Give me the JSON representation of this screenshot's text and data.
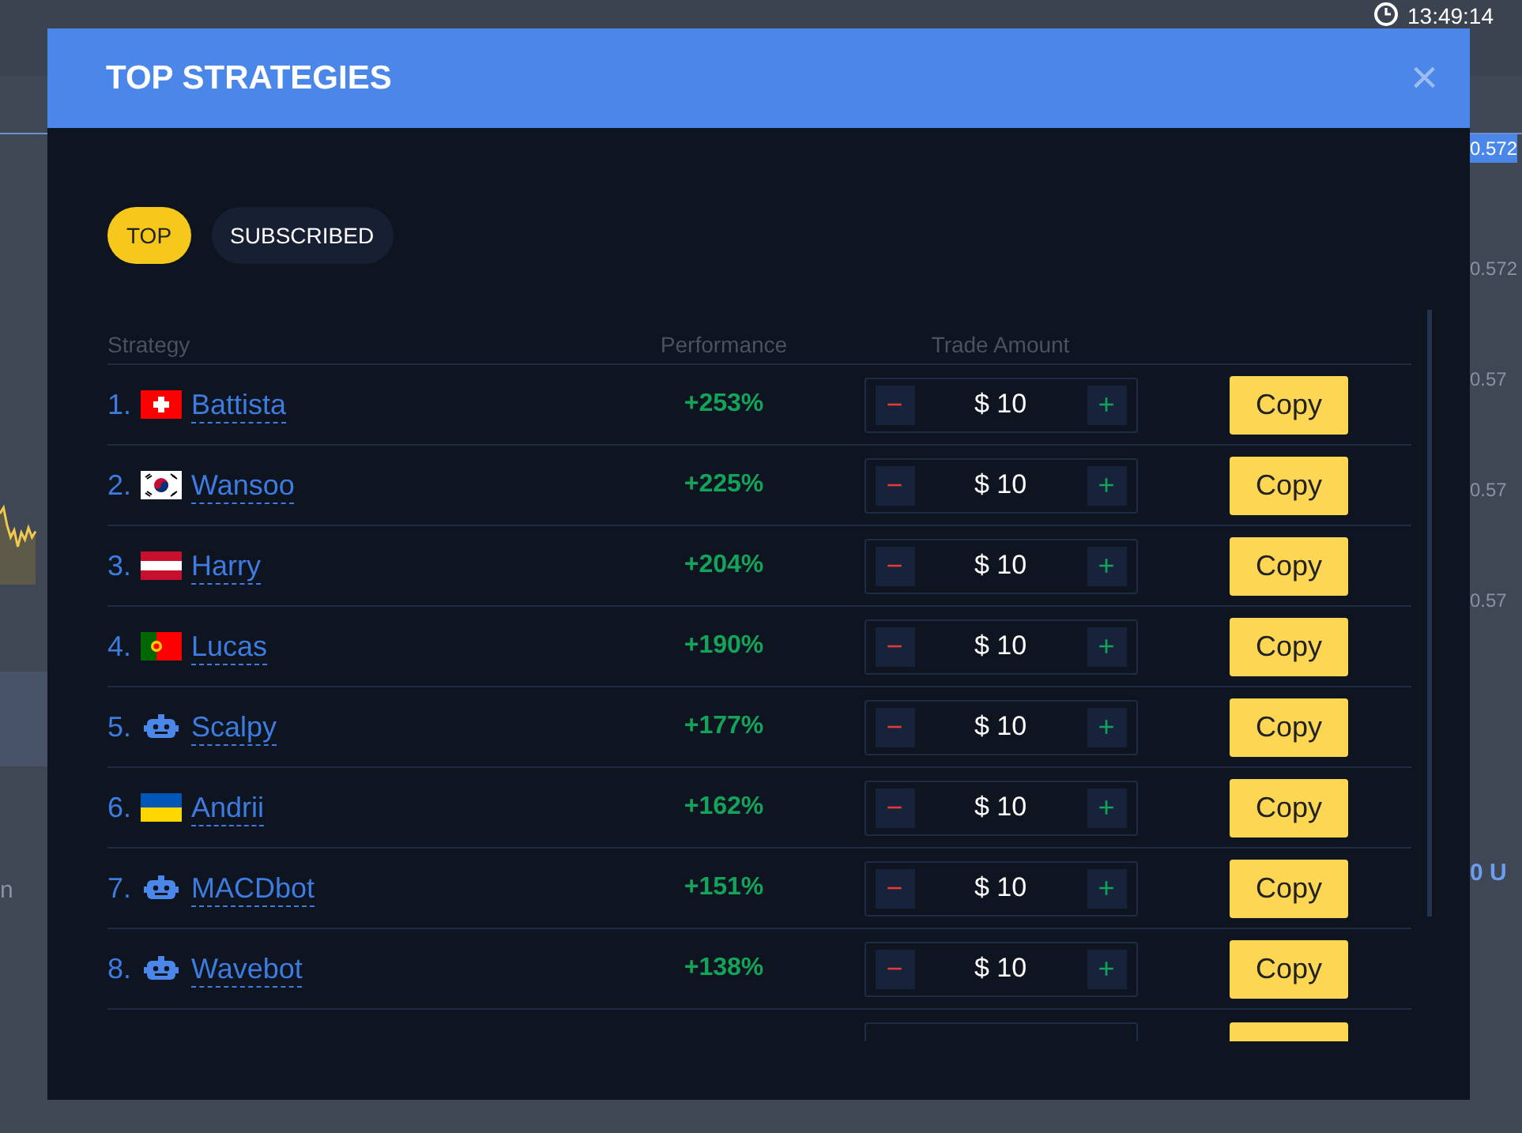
{
  "background": {
    "clock": "13:49:14",
    "price_labels": [
      {
        "text": "0.572",
        "selected": true
      },
      {
        "text": "0.572",
        "selected": false
      },
      {
        "text": "0.57",
        "selected": false
      },
      {
        "text": "0.57",
        "selected": false
      },
      {
        "text": "0.57",
        "selected": false
      }
    ],
    "balance_fragment": "0 U",
    "left_fragment": "n"
  },
  "modal": {
    "title": "TOP STRATEGIES",
    "close": "×",
    "tabs": [
      {
        "label": "TOP",
        "selected": true
      },
      {
        "label": "SUBSCRIBED",
        "selected": false
      }
    ],
    "table": {
      "columns": [
        "Strategy",
        "Performance",
        "Trade Amount"
      ],
      "rows": [
        {
          "rank": "1.",
          "kind": "switzerland",
          "name": "Battista",
          "performance": "+253%",
          "amount": "$ 10",
          "minus": "−",
          "plus": "+",
          "action": "Copy"
        },
        {
          "rank": "2.",
          "kind": "korea",
          "name": "Wansoo",
          "performance": "+225%",
          "amount": "$ 10",
          "minus": "−",
          "plus": "+",
          "action": "Copy"
        },
        {
          "rank": "3.",
          "kind": "austria",
          "name": "Harry",
          "performance": "+204%",
          "amount": "$ 10",
          "minus": "−",
          "plus": "+",
          "action": "Copy"
        },
        {
          "rank": "4.",
          "kind": "portugal",
          "name": "Lucas",
          "performance": "+190%",
          "amount": "$ 10",
          "minus": "−",
          "plus": "+",
          "action": "Copy"
        },
        {
          "rank": "5.",
          "kind": "bot",
          "name": "Scalpy",
          "performance": "+177%",
          "amount": "$ 10",
          "minus": "−",
          "plus": "+",
          "action": "Copy"
        },
        {
          "rank": "6.",
          "kind": "ukraine",
          "name": "Andrii",
          "performance": "+162%",
          "amount": "$ 10",
          "minus": "−",
          "plus": "+",
          "action": "Copy"
        },
        {
          "rank": "7.",
          "kind": "bot",
          "name": "MACDbot",
          "performance": "+151%",
          "amount": "$ 10",
          "minus": "−",
          "plus": "+",
          "action": "Copy"
        },
        {
          "rank": "8.",
          "kind": "bot",
          "name": "Wavebot",
          "performance": "+138%",
          "amount": "$ 10",
          "minus": "−",
          "plus": "+",
          "action": "Copy"
        }
      ],
      "more_rows_below": true
    }
  }
}
